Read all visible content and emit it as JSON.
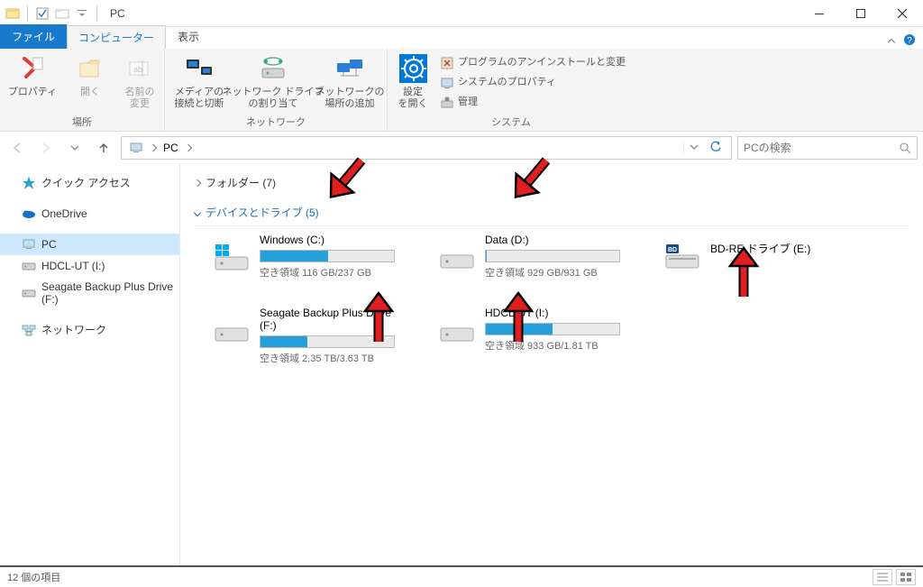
{
  "title": "PC",
  "tabs": {
    "file": "ファイル",
    "computer": "コンピューター",
    "view": "表示"
  },
  "ribbon": {
    "group1": {
      "label": "場所",
      "properties": "プロパティ",
      "open": "開く",
      "rename": "名前の\n変更"
    },
    "group2": {
      "label": "ネットワーク",
      "media": "メディアの\n接続と切断",
      "mapdrive": "ネットワーク ドライブ\nの割り当て",
      "addloc": "ネットワークの\n場所の追加"
    },
    "group3": {
      "label": "システム",
      "settings": "設定\nを開く",
      "uninstall": "プログラムのアンインストールと変更",
      "sysprop": "システムのプロパティ",
      "manage": "管理"
    }
  },
  "address": {
    "location": "PC",
    "chev": "›"
  },
  "search": {
    "placeholder": "PCの検索"
  },
  "sidebar": {
    "quick": "クイック アクセス",
    "onedrive": "OneDrive",
    "pc": "PC",
    "hdcl": "HDCL-UT (I:)",
    "seagate": "Seagate Backup Plus Drive (F:)",
    "network": "ネットワーク"
  },
  "sections": {
    "folders": "フォルダー (7)",
    "drives": "デバイスとドライブ (5)"
  },
  "drives": [
    {
      "label": "Windows (C:)",
      "free_label": "空き領域 116 GB/237 GB",
      "fill_pct": 51,
      "type": "os"
    },
    {
      "label": "Data (D:)",
      "free_label": "空き領域 929 GB/931 GB",
      "fill_pct": 1,
      "type": "hdd"
    },
    {
      "label": "BD-RE ドライブ (E:)",
      "free_label": "",
      "fill_pct": null,
      "type": "bd"
    },
    {
      "label": "Seagate Backup Plus Drive (F:)",
      "free_label": "空き領域 2.35 TB/3.63 TB",
      "fill_pct": 35,
      "type": "hdd"
    },
    {
      "label": "HDCL-UT (I:)",
      "free_label": "空き領域 933 GB/1.81 TB",
      "fill_pct": 50,
      "type": "hdd"
    }
  ],
  "status": {
    "items": "12 個の項目"
  }
}
